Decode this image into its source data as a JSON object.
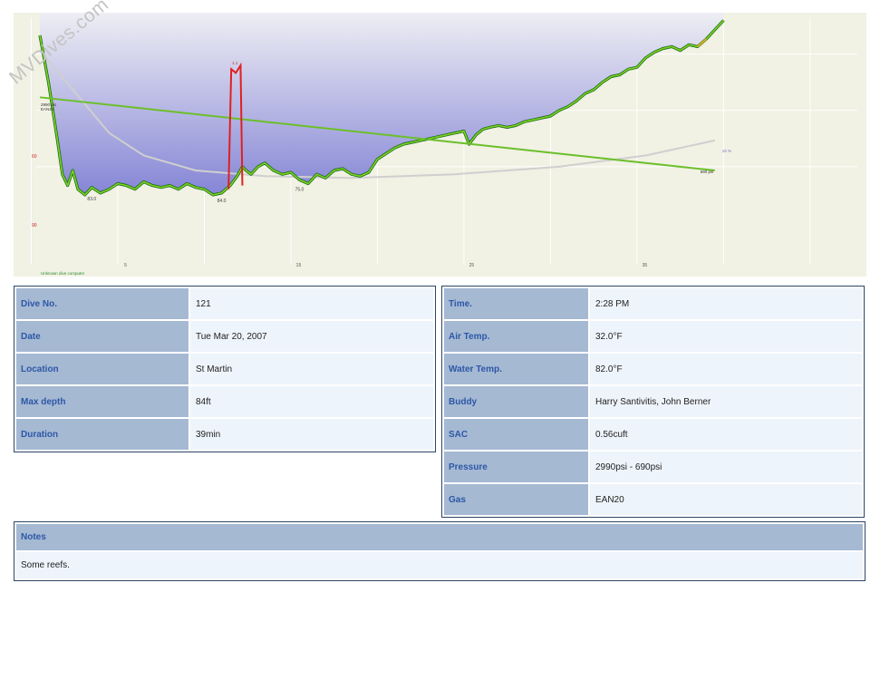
{
  "watermark": "MVDives.com",
  "chart_data": {
    "type": "line",
    "x_unit": "min",
    "y_unit": "ft",
    "xlim": [
      0,
      41
    ],
    "ylim": [
      0,
      100
    ],
    "y_inverted": true,
    "grid": true,
    "y_tick_labels": [
      "60",
      "90"
    ],
    "x_tick_labels": [
      "5",
      "15",
      "25",
      "35"
    ],
    "depth_profile": {
      "x": [
        0,
        0.5,
        1,
        1.3,
        1.6,
        1.9,
        2.2,
        2.6,
        3,
        3.5,
        4,
        4.5,
        5,
        5.5,
        6,
        6.5,
        7,
        7.5,
        8,
        8.5,
        9,
        9.5,
        10,
        10.5,
        11,
        11.4,
        11.7,
        11.9,
        12.2,
        12.6,
        13,
        13.5,
        14,
        14.5,
        15,
        15.5,
        16,
        16.5,
        17,
        17.5,
        18,
        18.5,
        19,
        19.5,
        20,
        20.5,
        21,
        21.5,
        22,
        22.5,
        23,
        23.5,
        24,
        24.5,
        24.8,
        25.2,
        25.6,
        26,
        26.5,
        27,
        27.5,
        28,
        28.5,
        29,
        29.5,
        30,
        30.5,
        31,
        31.5,
        32,
        32.5,
        33,
        33.5,
        34,
        34.5,
        35,
        35.5,
        36,
        36.5,
        37,
        37.5,
        38,
        38.5,
        39,
        39.5
      ],
      "depth": [
        0,
        25,
        55,
        74,
        80,
        72,
        82,
        85,
        81,
        84,
        82,
        79,
        80,
        82,
        78,
        80,
        81,
        80,
        82,
        79,
        81,
        82,
        85,
        84,
        80,
        75,
        70,
        72,
        74,
        70,
        68,
        72,
        74,
        73,
        77,
        79,
        74,
        76,
        72,
        71,
        74,
        75,
        73,
        66,
        63,
        60,
        58,
        57,
        56,
        55,
        54,
        53,
        52,
        51,
        58,
        53,
        50,
        49,
        48,
        49,
        48,
        46,
        45,
        44,
        43,
        40,
        38,
        35,
        31,
        29,
        25,
        22,
        21,
        18,
        17,
        12,
        9,
        7,
        6,
        8,
        5,
        6,
        2,
        -3,
        -8
      ]
    },
    "depth_labels": [
      {
        "x": 3,
        "depth": 85,
        "text": "83.0"
      },
      {
        "x": 10.5,
        "depth": 86,
        "text": "84.0"
      },
      {
        "x": 15,
        "depth": 80,
        "text": "75.0"
      }
    ],
    "tank_pressure": {
      "start": {
        "x": 0,
        "label": "2990 psi",
        "gas": "EAN20"
      },
      "end": {
        "x": 39,
        "label": "690 psi"
      }
    },
    "ceiling_spike": {
      "x_start": 10.9,
      "x_end": 11.7,
      "label": "1.1"
    },
    "ndl_curve_end_label": "15 %",
    "dive_computer": "Unknown dive computer"
  },
  "left_table": {
    "rows": [
      {
        "label": "Dive No.",
        "value": "121"
      },
      {
        "label": "Date",
        "value": "Tue Mar 20, 2007"
      },
      {
        "label": "Location",
        "value": "St Martin"
      },
      {
        "label": "Max depth",
        "value": "84ft"
      },
      {
        "label": "Duration",
        "value": "39min"
      }
    ]
  },
  "right_table": {
    "rows": [
      {
        "label": "Time.",
        "value": "2:28 PM"
      },
      {
        "label": "Air Temp.",
        "value": "32.0°F"
      },
      {
        "label": "Water Temp.",
        "value": "82.0°F"
      },
      {
        "label": "Buddy",
        "value": "Harry Santivitis, John Berner"
      },
      {
        "label": "SAC",
        "value": "0.56cuft"
      },
      {
        "label": "Pressure",
        "value": "2990psi - 690psi"
      },
      {
        "label": "Gas",
        "value": "EAN20"
      }
    ]
  },
  "notes": {
    "label": "Notes",
    "value": "Some reefs."
  },
  "colors": {
    "chart_bg": "#f1f1e4",
    "profile_fill_top": "#eeeef4",
    "profile_fill_bottom": "#8a8ad8",
    "profile_line": "#1a6b1a",
    "profile_highlight": "#7ed321",
    "pressure_line": "#6bbf2a",
    "spike": "#e02020",
    "label_bg": "#a5b9d3",
    "label_text": "#2d57a6",
    "value_bg": "#eef4fb",
    "border": "#2d4565"
  }
}
